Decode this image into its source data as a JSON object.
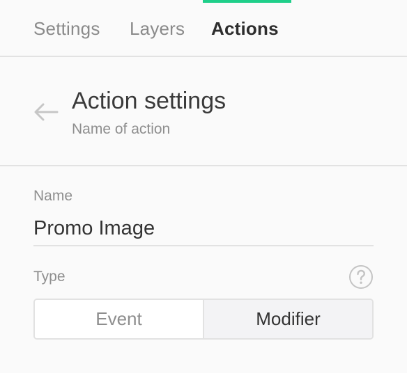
{
  "tabs": [
    {
      "label": "Settings",
      "active": false
    },
    {
      "label": "Layers",
      "active": false
    },
    {
      "label": "Actions",
      "active": true
    }
  ],
  "colors": {
    "accent": "#1fcf8a",
    "divider": "#e2e2e2",
    "muted_text": "#8e8e8e",
    "primary_text": "#3a3a3a",
    "background": "#fafafa"
  },
  "header": {
    "back_icon": "arrow-left-icon",
    "title": "Action settings",
    "subtitle": "Name of action"
  },
  "form": {
    "name": {
      "label": "Name",
      "value": "Promo Image"
    },
    "type": {
      "label": "Type",
      "help_icon": "question-circle-icon",
      "options": [
        "Event",
        "Modifier"
      ],
      "selected": "Modifier"
    }
  }
}
